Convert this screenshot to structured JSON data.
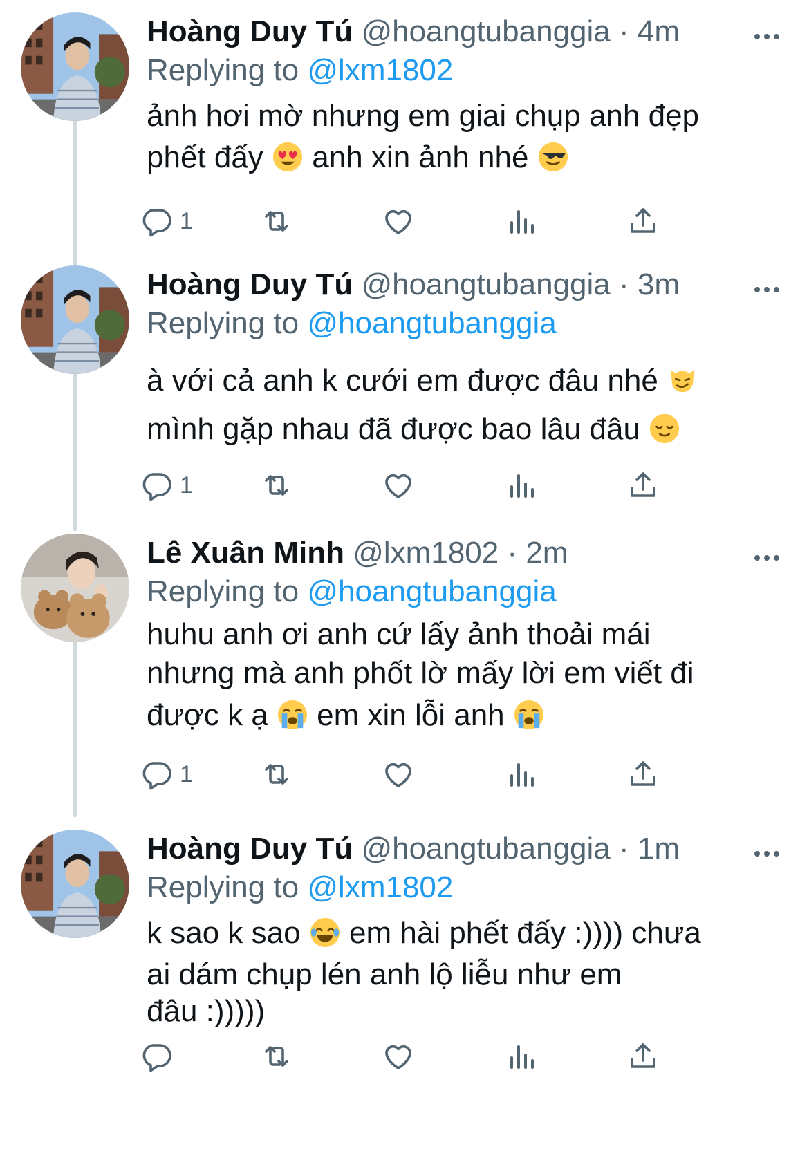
{
  "icons": {
    "reply": "reply-icon",
    "retweet": "retweet-icon",
    "like": "heart-icon",
    "views": "bar-chart-icon",
    "share": "share-icon",
    "more": "more-icon"
  },
  "colors": {
    "link": "#1d9bf0",
    "muted": "#536471",
    "text": "#0f1419",
    "thread": "#cfd9de"
  },
  "tweets": [
    {
      "name": "Hoàng Duy Tú",
      "meta": "@hoangtubanggia · 4m",
      "replying_label": "Replying to",
      "replying_to": "@lxm1802",
      "line1": "ảnh hơi mờ nhưng em giai chụp anh đẹp",
      "line2a": "phết đấy",
      "line2b": "anh xin ảnh nhé",
      "reply_count": "1"
    },
    {
      "name": "Hoàng Duy Tú",
      "meta": "@hoangtubanggia · 3m",
      "replying_label": "Replying to",
      "replying_to": "@hoangtubanggia",
      "line1": "à với cả anh k cưới em được đâu nhé",
      "line2": "mình gặp nhau đã được bao lâu đâu",
      "reply_count": "1"
    },
    {
      "name": "Lê Xuân Minh",
      "meta": "@lxm1802 · 2m",
      "replying_label": "Replying to",
      "replying_to": "@hoangtubanggia",
      "line1": "huhu anh ơi anh cứ lấy ảnh thoải mái",
      "line2": "nhưng mà anh phốt lờ mấy lời em viết đi",
      "line3a": "được k ạ",
      "line3b": "em xin lỗi anh",
      "reply_count": "1"
    },
    {
      "name": "Hoàng Duy Tú",
      "meta": "@hoangtubanggia · 1m",
      "replying_label": "Replying to",
      "replying_to": "@lxm1802",
      "line1a": "k sao k sao",
      "line1b": "em hài phết đấy :)))) chưa",
      "line2": "ai dám chụp lén anh lộ liễu như em",
      "line3": "đâu :)))))",
      "reply_count": ""
    }
  ]
}
